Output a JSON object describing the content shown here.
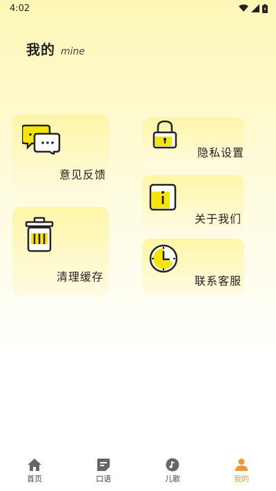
{
  "status_bar": {
    "time": "4:02"
  },
  "header": {
    "title": "我的",
    "subtitle": "mine"
  },
  "cards": {
    "feedback": "意见反馈",
    "clear_cache": "清理缓存",
    "privacy": "隐私设置",
    "about": "关于我们",
    "contact": "联系客服"
  },
  "nav": [
    {
      "label": "首页",
      "icon": "home-icon"
    },
    {
      "label": "口语",
      "icon": "speech-icon"
    },
    {
      "label": "儿歌",
      "icon": "music-icon"
    },
    {
      "label": "我的",
      "icon": "user-icon",
      "active": true
    }
  ],
  "colors": {
    "accent": "#f0963a",
    "icon_yellow": "#f6e40a",
    "card_top": "#fdf6a8"
  }
}
